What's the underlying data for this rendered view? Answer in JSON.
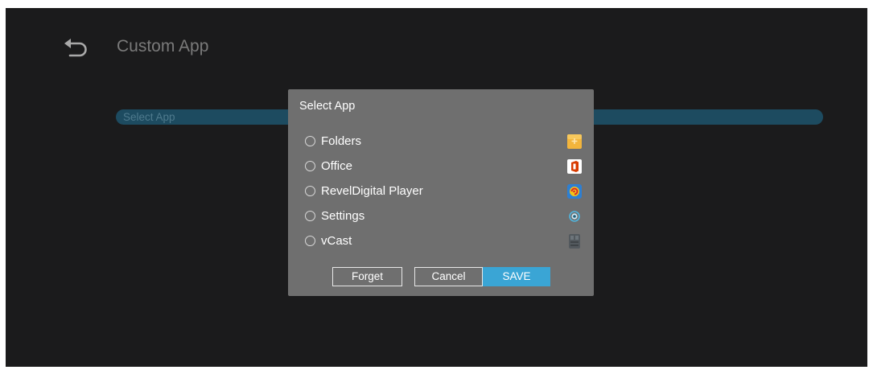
{
  "header": {
    "title": "Custom App"
  },
  "field": {
    "label": "Select App"
  },
  "dialog": {
    "title": "Select App",
    "options": [
      {
        "label": "Folders",
        "icon": "folders-icon"
      },
      {
        "label": "Office",
        "icon": "office-icon"
      },
      {
        "label": "RevelDigital Player",
        "icon": "reveldigital-icon"
      },
      {
        "label": "Settings",
        "icon": "settings-icon"
      },
      {
        "label": "vCast",
        "icon": "vcast-icon"
      }
    ],
    "buttons": {
      "forget": "Forget",
      "cancel": "Cancel",
      "save": "SAVE"
    }
  },
  "colors": {
    "background": "#1b1b1c",
    "dialog": "#6f6f6f",
    "accent": "#3aa5d5",
    "select_bar": "#1d4b60"
  }
}
